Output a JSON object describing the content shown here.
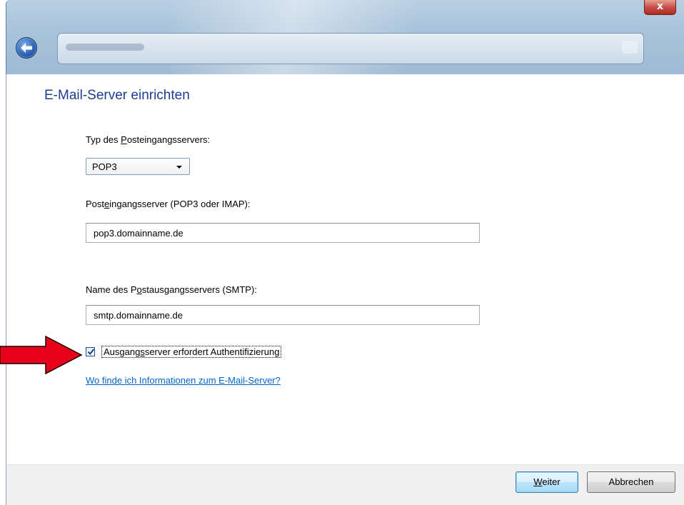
{
  "window": {
    "close_glyph": "x"
  },
  "heading": "E-Mail-Server einrichten",
  "incoming_type": {
    "label_pre": "Typ des ",
    "label_accel": "P",
    "label_post": "osteingangsservers:",
    "selected": "POP3"
  },
  "incoming_server": {
    "label_pre": "Post",
    "label_accel": "e",
    "label_post": "ingangsserver (POP3 oder IMAP):",
    "value": "pop3.domainname.de"
  },
  "outgoing_server": {
    "label_pre": "Name des P",
    "label_accel": "o",
    "label_post": "stausgangsservers (SMTP):",
    "value": "smtp.domainname.de"
  },
  "auth_checkbox": {
    "checked": true,
    "label_pre": "Ausgang",
    "label_accel": "s",
    "label_post": "server erfordert Authentifizierung"
  },
  "help_link": "Wo finde ich Informationen zum E-Mail-Server?",
  "buttons": {
    "next_accel": "W",
    "next_rest": "eiter",
    "cancel": "Abbrechen"
  },
  "colors": {
    "heading": "#1e3d8f",
    "link": "#0066cc",
    "annotation_arrow": "#e8001a"
  },
  "icons": {
    "back": "back-arrow-icon",
    "close": "close-icon",
    "check": "checkmark-icon",
    "pointer": "red-arrow-icon"
  }
}
